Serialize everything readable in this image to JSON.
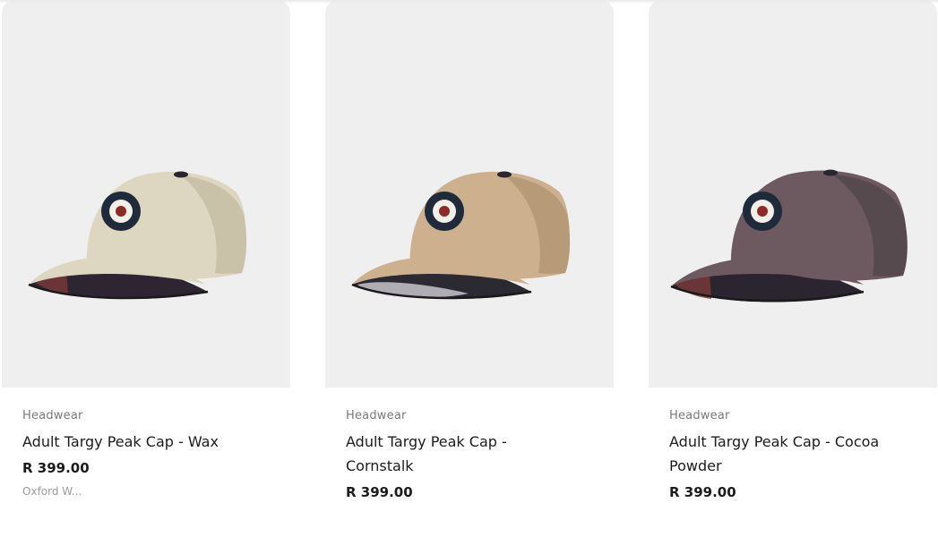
{
  "products": [
    {
      "category": "Headwear",
      "title": "Adult Targy Peak Cap - Wax",
      "price": "R 399.00",
      "brand_hint": "Oxford W...",
      "colors": {
        "crown": "#ddd6c0",
        "crown_shade": "#c9c1a8",
        "brim_under": "#2d2632",
        "target_outer": "#1f2a3a",
        "target_mid": "#f2efe8",
        "target_core": "#8e2a26"
      }
    },
    {
      "category": "Headwear",
      "title": "Adult Targy Peak Cap - Cornstalk",
      "price": "R 399.00",
      "colors": {
        "crown": "#cdb08d",
        "crown_shade": "#b79a78",
        "brim_under": "#2b2a33",
        "target_outer": "#1f2a3a",
        "target_mid": "#f2efe8",
        "target_core": "#8e2a26"
      }
    },
    {
      "category": "Headwear",
      "title": "Adult Targy Peak Cap - Cocoa Powder",
      "price": "R 399.00",
      "colors": {
        "crown": "#6c5a60",
        "crown_shade": "#574a4f",
        "brim_under": "#2b2530",
        "target_outer": "#1f2a3a",
        "target_mid": "#f2efe8",
        "target_core": "#8e2a26"
      }
    }
  ]
}
